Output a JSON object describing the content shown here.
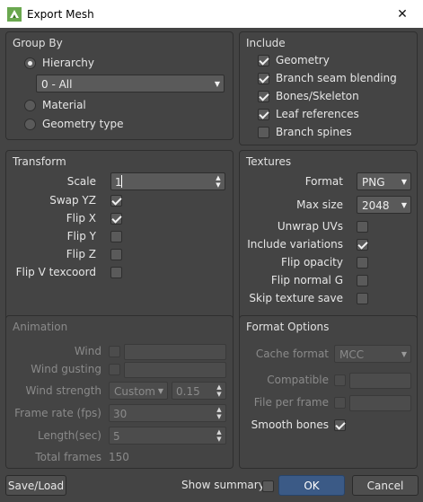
{
  "window": {
    "title": "Export Mesh",
    "close_glyph": "✕"
  },
  "group_by": {
    "title": "Group By",
    "hierarchy_label": "Hierarchy",
    "hierarchy_value": "0 - All",
    "material_label": "Material",
    "geometry_type_label": "Geometry type"
  },
  "include": {
    "title": "Include",
    "geometry": "Geometry",
    "branch_seam_blending": "Branch seam blending",
    "bones_skeleton": "Bones/Skeleton",
    "leaf_references": "Leaf references",
    "branch_spines": "Branch spines"
  },
  "transform": {
    "title": "Transform",
    "scale_label": "Scale",
    "scale_value": "1",
    "swap_yz": "Swap YZ",
    "flip_x": "Flip X",
    "flip_y": "Flip Y",
    "flip_z": "Flip Z",
    "flip_v": "Flip V texcoord"
  },
  "textures": {
    "title": "Textures",
    "format_label": "Format",
    "format_value": "PNG",
    "max_size_label": "Max size",
    "max_size_value": "2048",
    "unwrap_uvs": "Unwrap UVs",
    "include_variations": "Include variations",
    "flip_opacity": "Flip opacity",
    "flip_normal_g": "Flip normal G",
    "skip_texture_save": "Skip texture save"
  },
  "animation": {
    "title": "Animation",
    "wind": "Wind",
    "wind_gusting": "Wind gusting",
    "wind_strength_label": "Wind strength",
    "wind_strength_mode": "Custom",
    "wind_strength_value": "0.15",
    "frame_rate_label": "Frame rate (fps)",
    "frame_rate_value": "30",
    "length_label": "Length(sec)",
    "length_value": "5",
    "total_frames_label": "Total frames",
    "total_frames_value": "150"
  },
  "format_options": {
    "title": "Format Options",
    "cache_format_label": "Cache format",
    "cache_format_value": "MCC",
    "compatible": "Compatible",
    "file_per_frame": "File per frame",
    "smooth_bones": "Smooth bones"
  },
  "footer": {
    "save_load": "Save/Load",
    "show_summary": "Show summary",
    "ok": "OK",
    "cancel": "Cancel"
  }
}
